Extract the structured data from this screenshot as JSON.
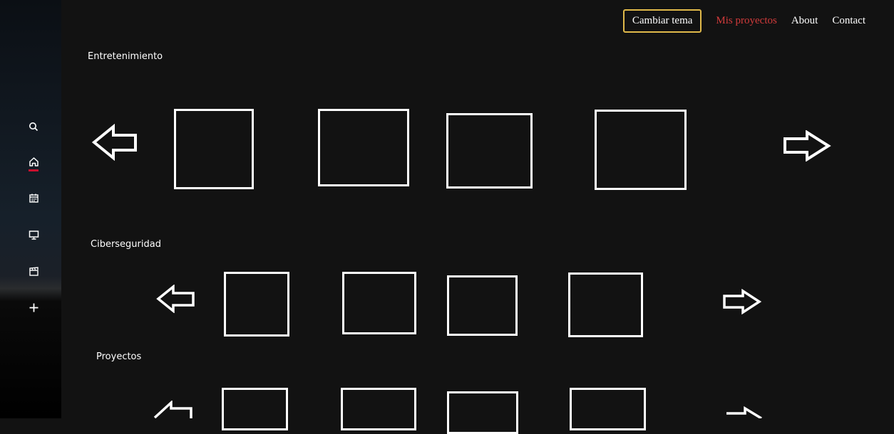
{
  "header": {
    "theme_button_label": "Cambiar tema",
    "nav_items": [
      "Mis proyectos",
      "About",
      "Contact"
    ],
    "current_nav": "Mis proyectos"
  },
  "sidebar": {
    "icons": [
      "search-icon",
      "home-icon",
      "calendar-icon",
      "monitor-icon",
      "clapperboard-icon",
      "plus-icon"
    ],
    "active_icon": "home-icon"
  },
  "sections": [
    {
      "title": "Entretenimiento"
    },
    {
      "title": "Ciberseguridad"
    },
    {
      "title": "Proyectos"
    }
  ],
  "colors": {
    "background": "#121212",
    "accent_red": "#c8102e",
    "nav_active": "#d23b3b",
    "theme_button_border": "#e0b94a",
    "outline": "#ffffff"
  }
}
